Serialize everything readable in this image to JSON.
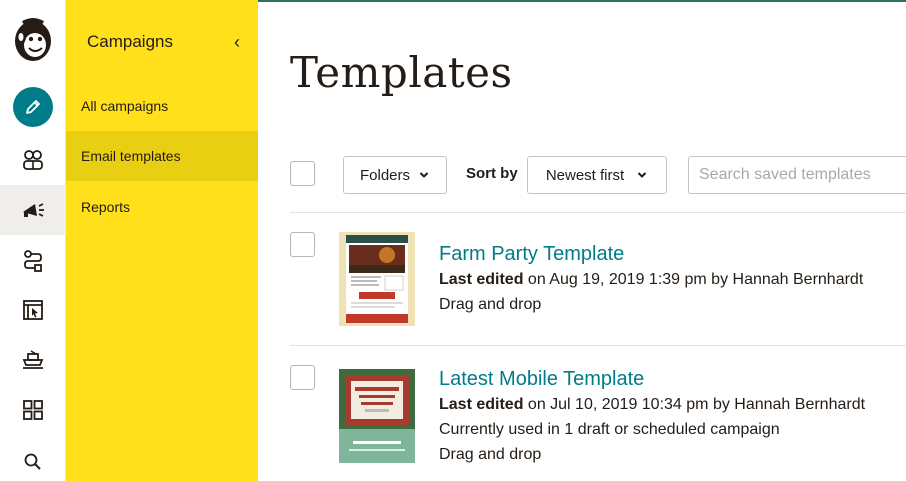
{
  "nav_rail": {
    "items": [
      {
        "name": "create",
        "icon": "pencil-icon"
      },
      {
        "name": "audience",
        "icon": "audience-icon"
      },
      {
        "name": "campaigns",
        "icon": "megaphone-icon"
      },
      {
        "name": "automations",
        "icon": "automation-icon"
      },
      {
        "name": "landing-pages",
        "icon": "website-icon"
      },
      {
        "name": "integrations",
        "icon": "integrations-icon"
      },
      {
        "name": "content",
        "icon": "grid-icon"
      },
      {
        "name": "search",
        "icon": "search-icon"
      }
    ]
  },
  "subnav": {
    "title": "Campaigns",
    "collapse_icon": "‹",
    "items": [
      {
        "label": "All campaigns"
      },
      {
        "label": "Email templates"
      },
      {
        "label": "Reports"
      }
    ]
  },
  "main": {
    "title": "Templates",
    "toolbar": {
      "folders_label": "Folders",
      "sort_by_label": "Sort by",
      "sort_value": "Newest first",
      "search_placeholder": "Search saved templates"
    },
    "templates": [
      {
        "name": "Farm Party Template",
        "last_edited_label": "Last edited",
        "last_edited_rest": " on Aug 19, 2019 1:39 pm by Hannah Bernhardt",
        "type": "Drag and drop"
      },
      {
        "name": "Latest Mobile Template",
        "last_edited_label": "Last edited",
        "last_edited_rest": " on Jul 10, 2019 10:34 pm by Hannah Bernhardt",
        "usage": "Currently used in 1 draft or scheduled campaign",
        "type": "Drag and drop"
      }
    ]
  },
  "colors": {
    "brand_yellow": "#ffe01b",
    "accent_teal": "#007c89",
    "text": "#241c15"
  }
}
